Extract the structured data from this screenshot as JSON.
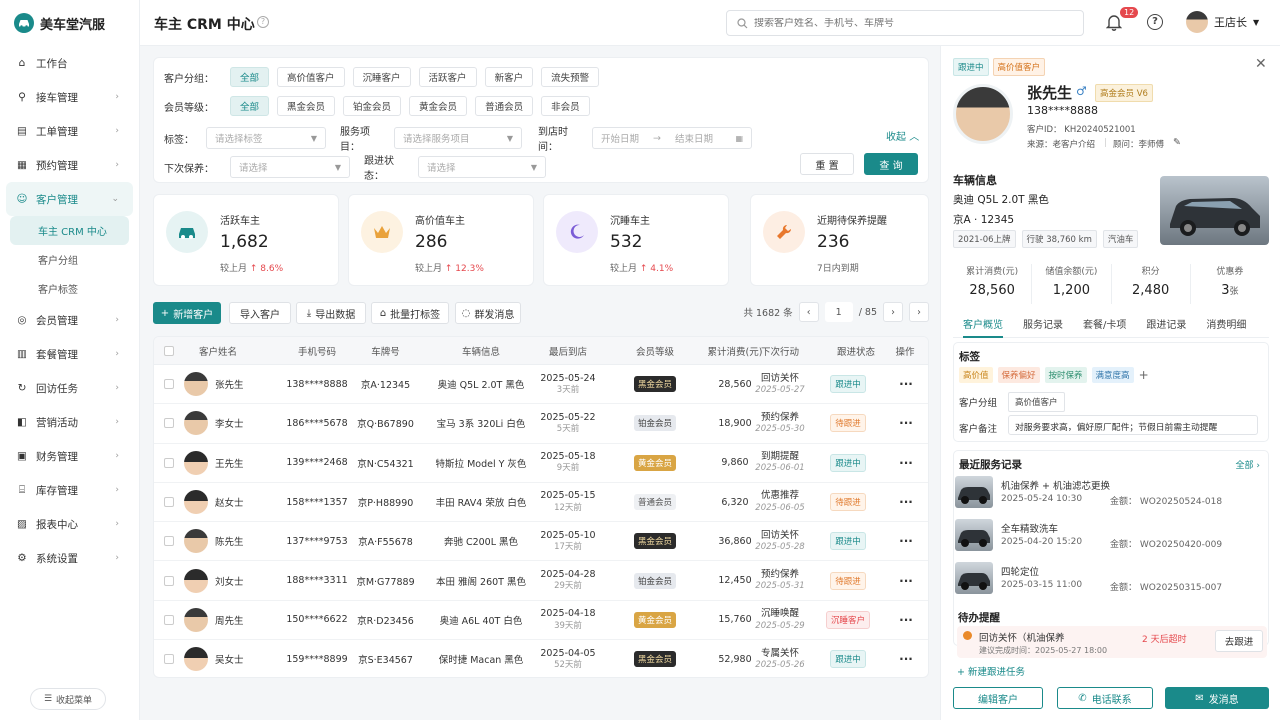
{
  "app": {
    "name": "美车堂汽服"
  },
  "sidebar": {
    "items": [
      {
        "label": "工作台",
        "icon": "home-icon"
      },
      {
        "label": "接车管理",
        "icon": "car-entry-icon"
      },
      {
        "label": "工单管理",
        "icon": "clipboard-icon"
      },
      {
        "label": "预约管理",
        "icon": "calendar-icon"
      },
      {
        "label": "客户管理",
        "icon": "user-icon"
      },
      {
        "label": "会员管理",
        "icon": "member-icon"
      },
      {
        "label": "套餐管理",
        "icon": "package-icon"
      },
      {
        "label": "回访任务",
        "icon": "callback-icon"
      },
      {
        "label": "营销活动",
        "icon": "marketing-icon"
      },
      {
        "label": "财务管理",
        "icon": "wallet-icon"
      },
      {
        "label": "库存管理",
        "icon": "warehouse-icon"
      },
      {
        "label": "报表中心",
        "icon": "report-icon"
      },
      {
        "label": "系统设置",
        "icon": "gear-icon"
      }
    ],
    "sub": [
      {
        "label": "车主 CRM 中心"
      },
      {
        "label": "客户分组"
      },
      {
        "label": "客户标签"
      }
    ],
    "collapse": "收起菜单"
  },
  "header": {
    "title": "车主 CRM 中心",
    "search_placeholder": "搜索客户姓名、手机号、车牌号",
    "notif": "12",
    "user": "王店长"
  },
  "filters": {
    "group_label": "客户分组：",
    "groups": [
      "全部",
      "高价值客户",
      "沉睡客户",
      "活跃客户",
      "新客户",
      "流失预警"
    ],
    "level_label": "会员等级：",
    "levels": [
      "全部",
      "黑金会员",
      "铂金会员",
      "黄金会员",
      "普通会员",
      "非会员"
    ],
    "tag_label": "标签：",
    "tag_ph": "请选择标签",
    "service_label": "服务项目：",
    "service_ph": "请选择服务项目",
    "visit_label": "到店时间：",
    "start_ph": "开始日期",
    "end_ph": "结束日期",
    "collapse": "收起",
    "next_label": "下次保养：",
    "next_ph": "请选择",
    "follow_label": "跟进状态：",
    "follow_ph": "请选择",
    "reset": "重 置",
    "query": "查 询"
  },
  "stats": [
    {
      "label": "活跃车主",
      "value": "1,682",
      "sub": "较上月",
      "delta": "8.6%",
      "icon": "car-icon",
      "color": "#1a8a8a"
    },
    {
      "label": "高价值车主",
      "value": "286",
      "sub": "较上月",
      "delta": "12.3%",
      "icon": "crown-icon",
      "color": "#e9a23b"
    },
    {
      "label": "沉睡车主",
      "value": "532",
      "sub": "较上月",
      "delta": "4.1%",
      "icon": "moon-icon",
      "color": "#7b5cd6"
    },
    {
      "label": "近期待保养提醒",
      "value": "236",
      "sub": "7日内到期",
      "delta": "",
      "icon": "wrench-icon",
      "color": "#e8782d"
    }
  ],
  "toolbar": {
    "add": "新增客户",
    "import": "导入客户",
    "export": "导出数据",
    "tag": "批量打标签",
    "msg": "群发消息",
    "total": "共 1682 条",
    "page": "1",
    "pages": "/ 85"
  },
  "table": {
    "headers": [
      "客户姓名",
      "手机号码",
      "车牌号",
      "车辆信息",
      "最后到店",
      "会员等级",
      "累计消费(元)",
      "下次行动",
      "跟进状态",
      "操作"
    ],
    "rows": [
      {
        "name": "张先生",
        "phone": "138****8888",
        "plate": "京A·12345",
        "car": "奥迪 Q5L 2.0T 黑色",
        "date": "2025-05-24",
        "ago": "3天前",
        "level": "黑金会员",
        "lv": "black",
        "spend": "28,560",
        "action": "回访关怀",
        "adate": "2025-05-27",
        "status": "跟进中",
        "st": "follow",
        "g": "m"
      },
      {
        "name": "李女士",
        "phone": "186****5678",
        "plate": "京Q·B67890",
        "car": "宝马 3系 320Li 白色",
        "date": "2025-05-22",
        "ago": "5天前",
        "level": "铂金会员",
        "lv": "plat",
        "spend": "18,900",
        "action": "预约保养",
        "adate": "2025-05-30",
        "status": "待跟进",
        "st": "pending",
        "g": "m"
      },
      {
        "name": "王先生",
        "phone": "139****2468",
        "plate": "京N·C54321",
        "car": "特斯拉 Model Y 灰色",
        "date": "2025-05-18",
        "ago": "9天前",
        "level": "黄金会员",
        "lv": "gold",
        "spend": "9,860",
        "action": "到期提醒",
        "adate": "2025-06-01",
        "status": "跟进中",
        "st": "follow",
        "g": "f"
      },
      {
        "name": "赵女士",
        "phone": "158****1357",
        "plate": "京P·H88990",
        "car": "丰田 RAV4 荣放 白色",
        "date": "2025-05-15",
        "ago": "12天前",
        "level": "普通会员",
        "lv": "norm",
        "spend": "6,320",
        "action": "优惠推荐",
        "adate": "2025-06-05",
        "status": "待跟进",
        "st": "pending",
        "g": "f"
      },
      {
        "name": "陈先生",
        "phone": "137****9753",
        "plate": "京A·F55678",
        "car": "奔驰 C200L 黑色",
        "date": "2025-05-10",
        "ago": "17天前",
        "level": "黑金会员",
        "lv": "black",
        "spend": "36,860",
        "action": "回访关怀",
        "adate": "2025-05-28",
        "status": "跟进中",
        "st": "follow",
        "g": "m"
      },
      {
        "name": "刘女士",
        "phone": "188****3311",
        "plate": "京M·G77889",
        "car": "本田 雅阁 260T 黑色",
        "date": "2025-04-28",
        "ago": "29天前",
        "level": "铂金会员",
        "lv": "plat",
        "spend": "12,450",
        "action": "预约保养",
        "adate": "2025-05-31",
        "status": "待跟进",
        "st": "pending",
        "g": "f"
      },
      {
        "name": "周先生",
        "phone": "150****6622",
        "plate": "京R·D23456",
        "car": "奥迪 A6L 40T 白色",
        "date": "2025-04-18",
        "ago": "39天前",
        "level": "黄金会员",
        "lv": "gold",
        "spend": "15,760",
        "action": "沉睡唤醒",
        "adate": "2025-05-29",
        "status": "沉睡客户",
        "st": "dorm",
        "g": "m"
      },
      {
        "name": "吴女士",
        "phone": "159****8899",
        "plate": "京S·E34567",
        "car": "保时捷 Macan 黑色",
        "date": "2025-04-05",
        "ago": "52天前",
        "level": "黑金会员",
        "lv": "black",
        "spend": "52,980",
        "action": "专属关怀",
        "adate": "2025-05-26",
        "status": "跟进中",
        "st": "follow",
        "g": "f"
      }
    ]
  },
  "detail": {
    "tags_top": [
      "跟进中",
      "高价值客户"
    ],
    "name": "张先生",
    "gender": "♂",
    "level": "高金会员 V6",
    "phone": "138****8888",
    "id": "客户ID： KH20240521001",
    "source": "来源：老客户介绍",
    "advisor": "顾问：李师傅",
    "car_title": "车辆信息",
    "car_model": "奥迪 Q5L 2.0T 黑色",
    "car_plate": "京A · 12345",
    "car_tags": [
      "2021-06上牌",
      "行驶 38,760 km",
      "汽油车"
    ],
    "metrics": [
      {
        "k": "累计消费(元)",
        "v": "28,560"
      },
      {
        "k": "储值余额(元)",
        "v": "1,200"
      },
      {
        "k": "积分",
        "v": "2,480"
      },
      {
        "k": "优惠券",
        "v": "3",
        "u": "张"
      }
    ],
    "tabs": [
      "客户概览",
      "服务记录",
      "套餐/卡项",
      "跟进记录",
      "消费明细"
    ],
    "label_title": "标签",
    "labels": [
      "高价值",
      "保养偏好",
      "按时保养",
      "满意度高"
    ],
    "group_k": "客户分组",
    "group_v": "高价值客户",
    "note_k": "客户备注",
    "note_v": "对服务要求高，偏好原厂配件；节假日前需主动提醒",
    "svc_title": "最近服务记录",
    "svc_all": "全部",
    "services": [
      {
        "name": "机油保养 + 机油滤芯更换",
        "time": "2025-05-24 10:30",
        "no": "金额： WO20250524-018"
      },
      {
        "name": "全车精致洗车",
        "time": "2025-04-20 15:20",
        "no": "金额： WO20250420-009"
      },
      {
        "name": "四轮定位",
        "time": "2025-03-15 11:00",
        "no": "金额： WO20250315-007"
      }
    ],
    "todo_title": "待办提醒",
    "todo_text": "回访关怀（机油保养",
    "todo_sub": "建议完成时间：2025-05-27 18:00",
    "todo_due": "2 天后超时",
    "todo_btn": "去跟进",
    "new_task": "新建跟进任务",
    "btn_edit": "编辑客户",
    "btn_call": "电话联系",
    "btn_msg": "发消息"
  }
}
